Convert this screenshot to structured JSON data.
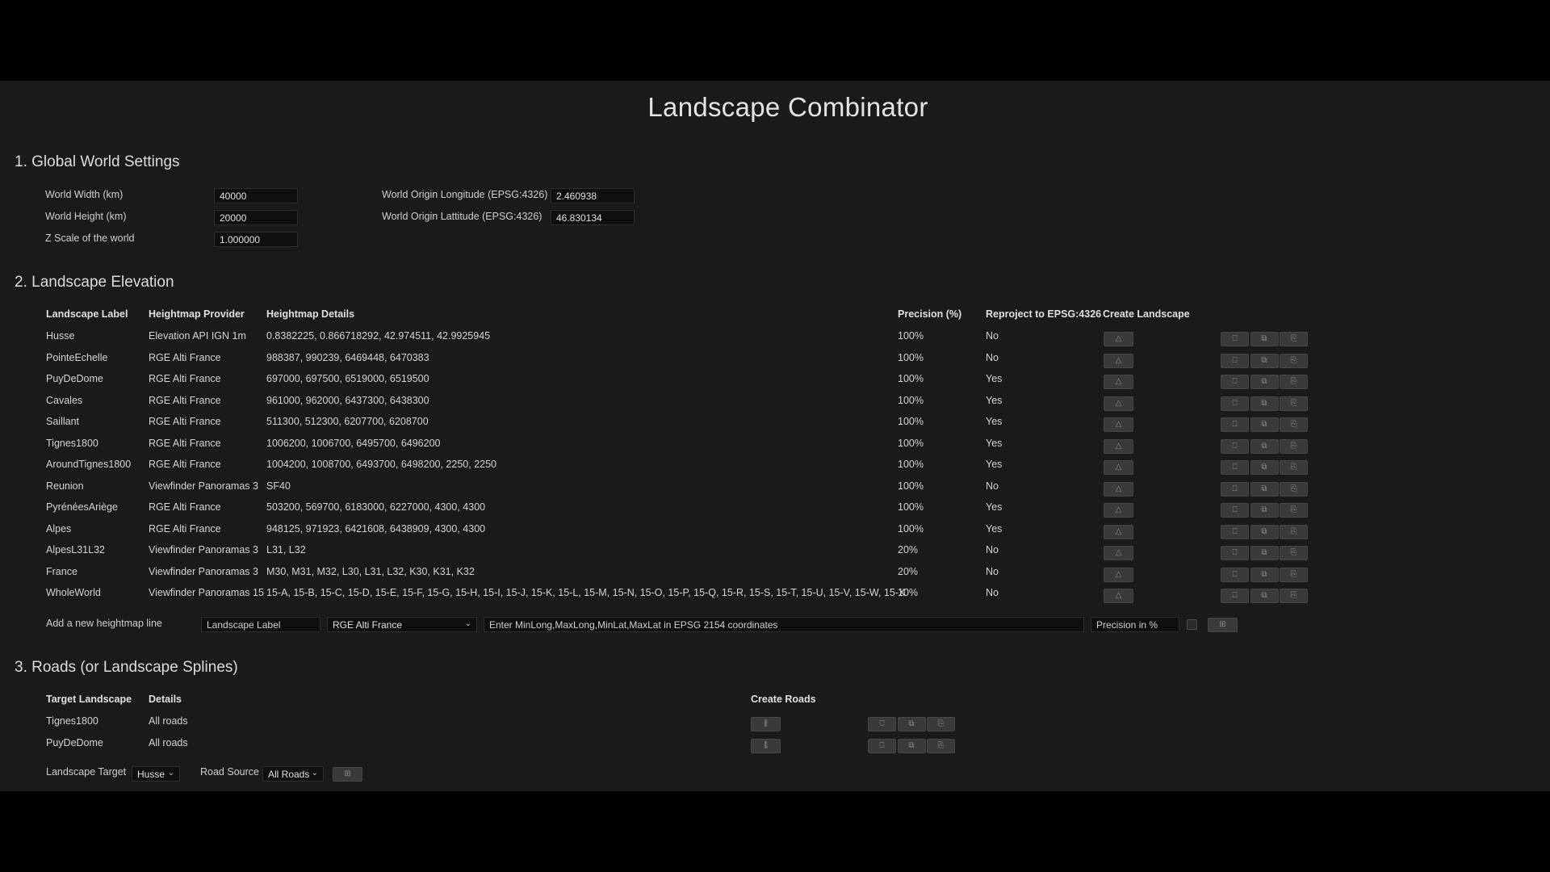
{
  "window": {
    "title": "Landscape Combinator"
  },
  "global": {
    "section_title": "1. Global World Settings",
    "world_width_label": "World Width (km)",
    "world_width_value": "40000",
    "world_height_label": "World Height (km)",
    "world_height_value": "20000",
    "z_scale_label": "Z Scale of the world",
    "z_scale_value": "1.000000",
    "origin_long_label": "World Origin Longitude (EPSG:4326)",
    "origin_long_value": "2.460938",
    "origin_lat_label": "World Origin Lattitude (EPSG:4326)",
    "origin_lat_value": "46.830134"
  },
  "elevation": {
    "section_title": "2. Landscape Elevation",
    "headers": {
      "label": "Landscape Label",
      "provider": "Heightmap Provider",
      "details": "Heightmap Details",
      "precision": "Precision (%)",
      "reproject": "Reproject to EPSG:4326",
      "create": "Create Landscape"
    },
    "rows": [
      {
        "label": "Husse",
        "provider": "Elevation API IGN 1m",
        "details": "0.8382225, 0.866718292, 42.974511, 42.9925945",
        "precision": "100%",
        "reproject": "No"
      },
      {
        "label": "PointeEchelle",
        "provider": "RGE Alti France",
        "details": "988387, 990239, 6469448, 6470383",
        "precision": "100%",
        "reproject": "No"
      },
      {
        "label": "PuyDeDome",
        "provider": "RGE Alti France",
        "details": "697000, 697500, 6519000, 6519500",
        "precision": "100%",
        "reproject": "Yes"
      },
      {
        "label": "Cavales",
        "provider": "RGE Alti France",
        "details": "961000, 962000, 6437300, 6438300",
        "precision": "100%",
        "reproject": "Yes"
      },
      {
        "label": "Saillant",
        "provider": "RGE Alti France",
        "details": "511300, 512300, 6207700, 6208700",
        "precision": "100%",
        "reproject": "Yes"
      },
      {
        "label": "Tignes1800",
        "provider": "RGE Alti France",
        "details": "1006200, 1006700, 6495700, 6496200",
        "precision": "100%",
        "reproject": "Yes"
      },
      {
        "label": "AroundTignes1800",
        "provider": "RGE Alti France",
        "details": "1004200, 1008700, 6493700, 6498200, 2250, 2250",
        "precision": "100%",
        "reproject": "Yes"
      },
      {
        "label": "Reunion",
        "provider": "Viewfinder Panoramas 3",
        "details": "SF40",
        "precision": "100%",
        "reproject": "No"
      },
      {
        "label": "PyrénéesAriège",
        "provider": "RGE Alti France",
        "details": "503200, 569700, 6183000, 6227000, 4300, 4300",
        "precision": "100%",
        "reproject": "Yes"
      },
      {
        "label": "Alpes",
        "provider": "RGE Alti France",
        "details": "948125, 971923, 6421608, 6438909, 4300, 4300",
        "precision": "100%",
        "reproject": "Yes"
      },
      {
        "label": "AlpesL31L32",
        "provider": "Viewfinder Panoramas 3",
        "details": "L31, L32",
        "precision": "20%",
        "reproject": "No"
      },
      {
        "label": "France",
        "provider": "Viewfinder Panoramas 3",
        "details": "M30, M31, M32, L30, L31, L32, K30, K31, K32",
        "precision": "20%",
        "reproject": "No"
      },
      {
        "label": "WholeWorld",
        "provider": "Viewfinder Panoramas 15",
        "details": "15-A, 15-B, 15-C, 15-D, 15-E, 15-F, 15-G, 15-H, 15-I, 15-J, 15-K, 15-L, 15-M, 15-N, 15-O, 15-P, 15-Q, 15-R, 15-S, 15-T, 15-U, 15-V, 15-W, 15-X",
        "precision": "10%",
        "reproject": "No"
      }
    ],
    "add_line": {
      "label": "Add a new heightmap line",
      "label_placeholder": "Landscape Label",
      "provider_selected": "RGE Alti France",
      "coords_placeholder": "Enter MinLong,MaxLong,MinLat,MaxLat in EPSG 2154 coordinates",
      "precision_placeholder": "Precision in %"
    }
  },
  "roads": {
    "section_title": "3. Roads (or Landscape Splines)",
    "headers": {
      "target": "Target Landscape",
      "details": "Details",
      "create": "Create Roads"
    },
    "rows": [
      {
        "target": "Tignes1800",
        "details": "All roads"
      },
      {
        "target": "PuyDeDome",
        "details": "All roads"
      }
    ],
    "landscape_target_label": "Landscape Target",
    "landscape_target_value": "Husse",
    "road_source_label": "Road Source",
    "road_source_value": "All Roads"
  },
  "icons": {
    "create_landscape": "mountain-icon",
    "delete": "trash-icon",
    "copy": "copy-icon",
    "paste": "paste-icon",
    "add": "plus-icon",
    "create_roads": "road-icon"
  },
  "colors": {
    "background": "#000000",
    "panel": "#1a1a1a",
    "button": "#3a3a3a",
    "text": "#d8d8d8"
  }
}
